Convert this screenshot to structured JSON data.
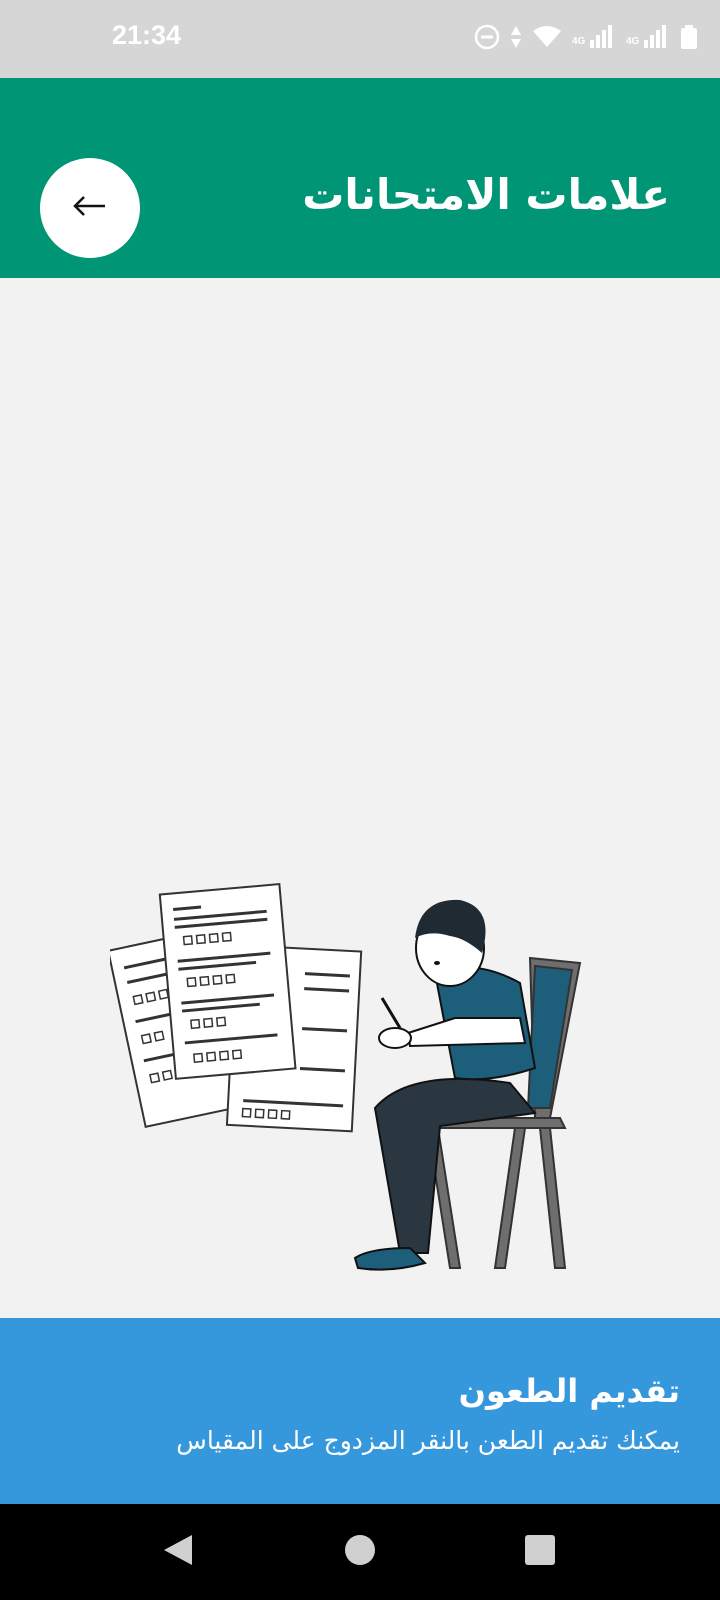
{
  "status_bar": {
    "time": "21:34",
    "icons": [
      "do-not-disturb-icon",
      "data-arrows-icon",
      "wifi-icon",
      "signal-4g-icon",
      "signal-4g-icon",
      "battery-icon"
    ],
    "network_label_1": "4G",
    "network_label_2": "4G"
  },
  "header": {
    "title": "علامات الامتحانات",
    "back_icon": "arrow-left-icon",
    "background_color": "#009574"
  },
  "info_panel": {
    "title": "تقديم الطعون",
    "description": "يمكنك تقديم الطعن بالنقر المزدوج على المقياس",
    "background_color": "#3597dc"
  },
  "nav_bar": {
    "back_icon": "triangle-back-icon",
    "home_icon": "circle-home-icon",
    "recents_icon": "square-recents-icon"
  },
  "illustration": {
    "subject": "student-writing-exam-icon",
    "accent_color": "#1d5f7a"
  }
}
